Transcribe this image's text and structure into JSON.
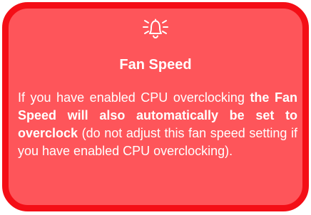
{
  "callout": {
    "icon": "bell-alert-icon",
    "colors": {
      "background": "#fe555a",
      "border": "#f40e16",
      "text": "#ffffff"
    },
    "title": "Fan Speed",
    "body": {
      "intro": "If you have enabled CPU overclocking ",
      "emphasis": "the Fan Speed will also automatically be set to overclock",
      "outro": " (do not adjust this fan speed setting if you have enabled CPU overclocking)."
    }
  }
}
